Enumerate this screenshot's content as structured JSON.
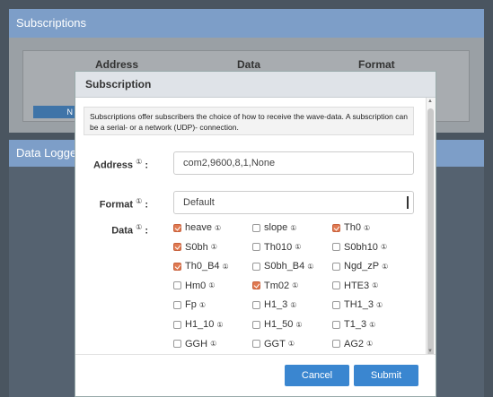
{
  "background": {
    "panel_title": "Subscriptions",
    "table_headers": [
      "Address",
      "Data",
      "Format"
    ],
    "small_button_label": "N",
    "datalogger_title": "Data Logge"
  },
  "modal": {
    "title": "Subscription",
    "info": "Subscriptions offer subscribers the choice of how to receive the wave-data. A subscription can be a serial- or a network (UDP)- connection.",
    "address_label": "Address",
    "address_value": "com2,9600,8,1,None",
    "format_label": "Format",
    "format_value": "Default",
    "data_label": "Data",
    "info_marker": "①",
    "colon": ":",
    "checkboxes": [
      {
        "label": "heave",
        "checked": true
      },
      {
        "label": "slope",
        "checked": false
      },
      {
        "label": "Th0",
        "checked": true
      },
      {
        "label": "S0bh",
        "checked": true
      },
      {
        "label": "Th010",
        "checked": false
      },
      {
        "label": "S0bh10",
        "checked": false
      },
      {
        "label": "Th0_B4",
        "checked": true
      },
      {
        "label": "S0bh_B4",
        "checked": false
      },
      {
        "label": "Ngd_zP",
        "checked": false
      },
      {
        "label": "Hm0",
        "checked": false
      },
      {
        "label": "Tm02",
        "checked": true
      },
      {
        "label": "HTE3",
        "checked": false
      },
      {
        "label": "Fp",
        "checked": false
      },
      {
        "label": "H1_3",
        "checked": false
      },
      {
        "label": "TH1_3",
        "checked": false
      },
      {
        "label": "H1_10",
        "checked": false
      },
      {
        "label": "H1_50",
        "checked": false
      },
      {
        "label": "T1_3",
        "checked": false
      },
      {
        "label": "GGH",
        "checked": false
      },
      {
        "label": "GGT",
        "checked": false
      },
      {
        "label": "AG2",
        "checked": false
      }
    ],
    "cancel_label": "Cancel",
    "submit_label": "Submit"
  },
  "colors": {
    "accent": "#3a86d0",
    "checked": "#e07a52",
    "header_bar": "#7d9ec8"
  }
}
